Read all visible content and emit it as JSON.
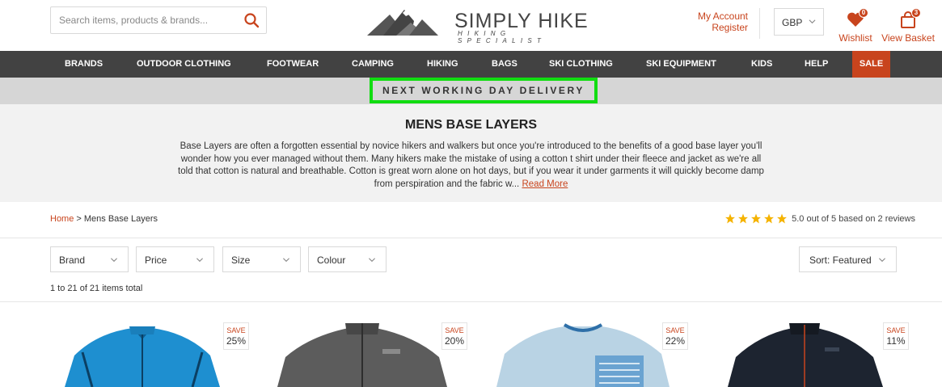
{
  "header": {
    "search_placeholder": "Search items, products & brands...",
    "logo_title": "SIMPLY HIKE",
    "logo_subtitle": "HIKING SPECIALIST",
    "my_account": "My Account",
    "register": "Register",
    "currency": "GBP",
    "wishlist_label": "Wishlist",
    "wishlist_count": "0",
    "basket_label": "View Basket",
    "basket_count": "3"
  },
  "nav": {
    "items": [
      "BRANDS",
      "OUTDOOR CLOTHING",
      "FOOTWEAR",
      "CAMPING",
      "HIKING",
      "BAGS",
      "SKI CLOTHING",
      "SKI EQUIPMENT",
      "KIDS",
      "HELP",
      "SALE"
    ]
  },
  "promo": {
    "text": "NEXT WORKING DAY DELIVERY"
  },
  "intro": {
    "title": "MENS BASE LAYERS",
    "body": "Base Layers are often a forgotten essential by novice hikers and walkers but once you're introduced to the benefits of a good base layer you'll wonder how you ever managed without them. Many hikers make the mistake of using a cotton t shirt under their fleece and jacket as we're all told that cotton is natural and breathable. Cotton is great worn alone on hot days, but if you wear it under garments it will quickly become damp from perspiration and the fabric w...",
    "read_more": "Read More"
  },
  "breadcrumb": {
    "home": "Home",
    "separator": " > ",
    "current": "Mens Base Layers"
  },
  "rating": {
    "stars": 5,
    "text": "5.0 out of 5 based on 2 reviews"
  },
  "filters": {
    "brand": "Brand",
    "price": "Price",
    "size": "Size",
    "colour": "Colour",
    "sort": "Sort: Featured"
  },
  "results": {
    "count_text": "1 to 21 of 21 items total"
  },
  "products": [
    {
      "save_label": "SAVE",
      "save_pct": "25%",
      "color": "#1e8fd0"
    },
    {
      "save_label": "SAVE",
      "save_pct": "20%",
      "color": "#5c5c5c"
    },
    {
      "save_label": "SAVE",
      "save_pct": "22%",
      "color": "#b9d3e4"
    },
    {
      "save_label": "SAVE",
      "save_pct": "11%",
      "color": "#1d2430"
    }
  ],
  "colors": {
    "accent": "#c8441d",
    "nav_bg": "#424242",
    "promo_bg": "#d6d6d6",
    "highlight": "#11dd11"
  }
}
